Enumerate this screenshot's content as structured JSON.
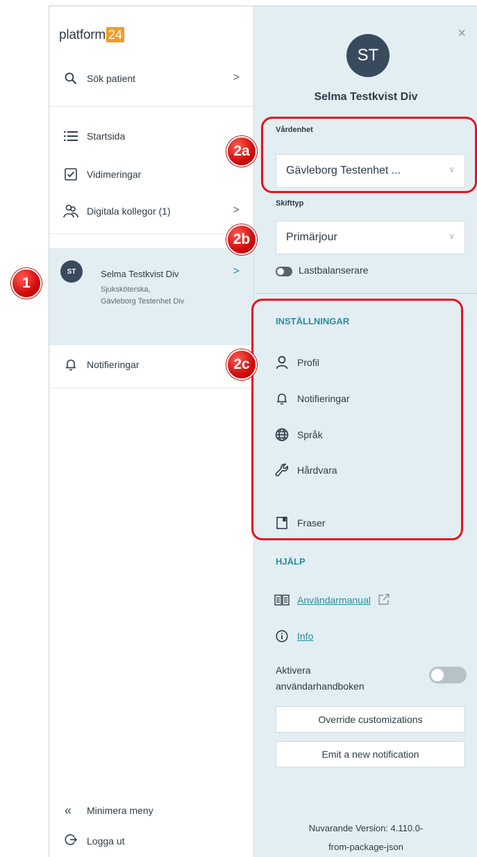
{
  "sidebar": {
    "logo_text": "platform",
    "logo_number": "24",
    "search_label": "Sök patient",
    "items": [
      {
        "label": "Startsida",
        "icon": "list-icon"
      },
      {
        "label": "Vidimeringar",
        "icon": "checkbox-icon"
      },
      {
        "label": "Digitala kollegor (1)",
        "icon": "people-icon"
      }
    ],
    "user": {
      "initials": "ST",
      "name": "Selma Testkvist Div",
      "role": "Sjuksköterska,",
      "unit": "Gävleborg Testenhet Div"
    },
    "notifications_label": "Notifieringar",
    "minimize_label": "Minimera meny",
    "logout_label": "Logga ut",
    "chevron": ">"
  },
  "panel": {
    "close": "×",
    "avatar_initials": "ST",
    "name": "Selma Testkvist Div",
    "vardenhet_label": "Vårdenhet",
    "vardenhet_value": "Gävleborg Testenhet ...",
    "skifttyp_label": "Skifttyp",
    "skifttyp_value": "Primärjour",
    "lastbalanserare_label": "Lastbalanserare",
    "settings_title": "INSTÄLLNINGAR",
    "settings": [
      {
        "label": "Profil",
        "icon": "person-icon"
      },
      {
        "label": "Notifieringar",
        "icon": "bell-icon"
      },
      {
        "label": "Språk",
        "icon": "globe-icon"
      },
      {
        "label": "Hårdvara",
        "icon": "wrench-icon"
      },
      {
        "label": "Fraser",
        "icon": "note-icon"
      }
    ],
    "help_title": "HJÄLP",
    "manual_label": "Användarmanual",
    "info_label": "Info",
    "activate_label": "Aktivera användarhandboken",
    "override_button": "Override customizations",
    "emit_button": "Emit a new notification",
    "version_line1": "Nuvarande Version: 4.110.0-",
    "version_line2": "from-package-json"
  },
  "annotations": {
    "marker_1": "1",
    "marker_2a": "2a",
    "marker_2b": "2b",
    "marker_2c": "2c",
    "color": "#e8111a"
  },
  "colors": {
    "accent": "#2a8c9c",
    "panel_bg": "#e3eef3",
    "logo_badge": "#f39c26",
    "avatar": "#394a5c"
  }
}
